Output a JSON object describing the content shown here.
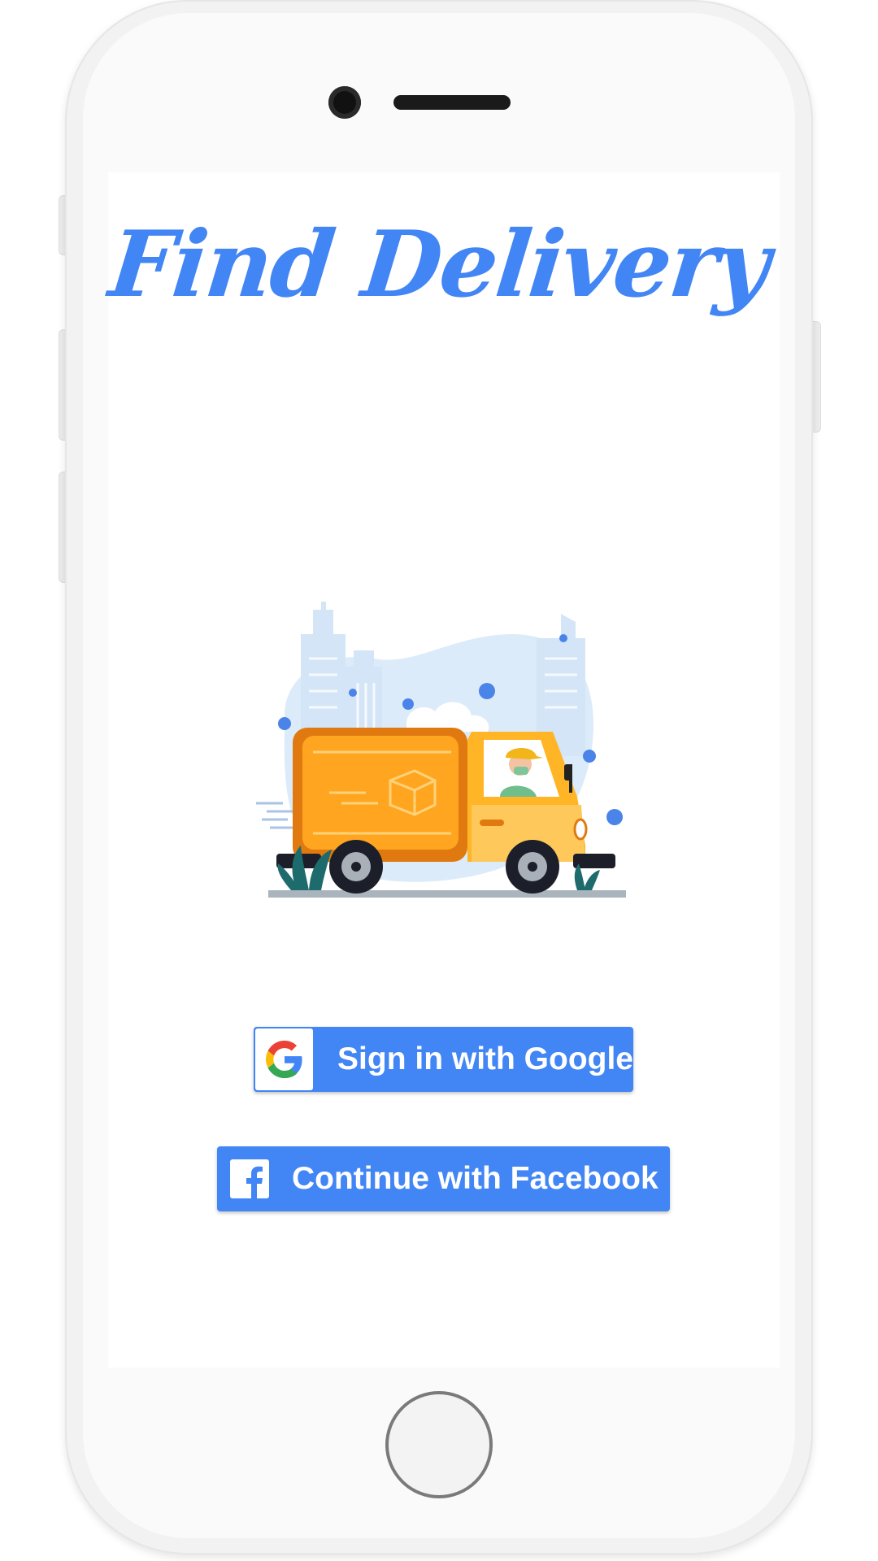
{
  "app": {
    "title": "Find Delivery"
  },
  "illustration": {
    "name": "delivery-truck-illustration"
  },
  "buttons": {
    "google_label": "Sign in with Google",
    "facebook_label": "Continue with Facebook"
  },
  "icons": {
    "google": "google-logo-icon",
    "facebook": "facebook-logo-icon"
  },
  "colors": {
    "accent": "#4285f4",
    "truck": "#ffa51f",
    "background": "#ffffff"
  }
}
